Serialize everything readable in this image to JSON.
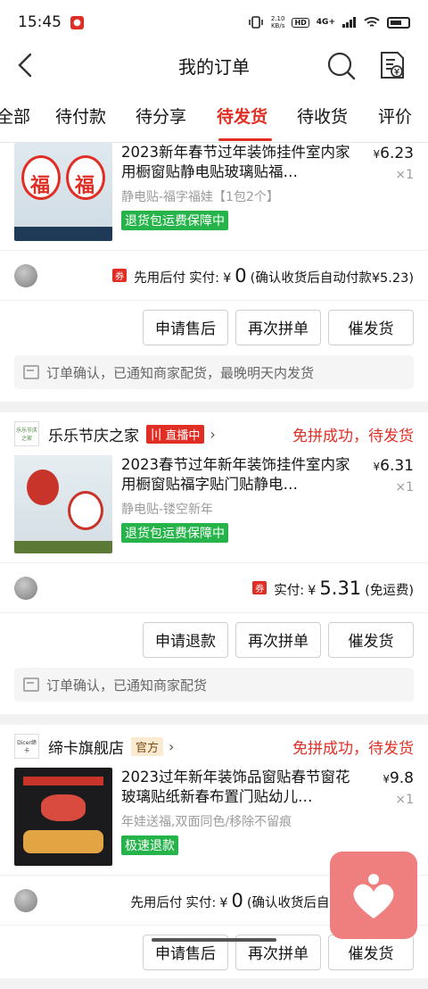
{
  "status_bar": {
    "time": "15:45",
    "net_speed_value": "2.10",
    "net_speed_unit": "KB/s",
    "hd": "HD",
    "signal": "4G+"
  },
  "nav": {
    "title": "我的订单"
  },
  "tabs": [
    {
      "label": "全部"
    },
    {
      "label": "待付款"
    },
    {
      "label": "待分享"
    },
    {
      "label": "待发货",
      "active": true
    },
    {
      "label": "待收货"
    },
    {
      "label": "评价"
    }
  ],
  "orders": [
    {
      "goods_title": "2023新年春节过年装饰挂件室内家用橱窗贴静电贴玻璃贴福…",
      "goods_spec": "静电贴-福字福娃【1包2个】",
      "guarantee": "退货包运费保障中",
      "price": "6.23",
      "quantity": "×1",
      "pay_prefix": "先用后付",
      "pay_label": "实付:",
      "pay_amount": "0",
      "pay_note": "(确认收货后自动付款¥5.23)",
      "coupon": "券",
      "buttons": [
        "申请售后",
        "再次拼单",
        "催发货"
      ],
      "notice": "订单确认，已通知商家配货，最晚明天内发货"
    },
    {
      "shop_name": "乐乐节庆之家",
      "shop_logo_text": "乐乐节庆之家",
      "shop_badge": "直播中",
      "status": "免拼成功，待发货",
      "goods_title": "2023春节过年新年装饰挂件室内家用橱窗贴福字贴门贴静电…",
      "goods_spec": "静电贴-镂空新年",
      "guarantee": "退货包运费保障中",
      "price": "6.31",
      "quantity": "×1",
      "pay_label": "实付:",
      "pay_amount": "5.31",
      "pay_note": "(免运费)",
      "coupon": "券",
      "buttons": [
        "申请退款",
        "再次拼单",
        "催发货"
      ],
      "notice": "订单确认，已通知商家配货"
    },
    {
      "shop_name": "缔卡旗舰店",
      "shop_logo_text": "Dicer缔卡",
      "shop_badge": "官方",
      "status": "免拼成功，待发货",
      "goods_title": "2023过年新年装饰品窗贴春节窗花玻璃贴纸新春布置门贴幼儿…",
      "goods_spec": "年娃送福,双面同色/移除不留痕",
      "guarantee": "极速退款",
      "price": "9.8",
      "quantity": "×1",
      "pay_prefix": "先用后付",
      "pay_label": "实付:",
      "pay_amount": "0",
      "pay_note": "(确认收货后自动",
      "buttons": [
        "申请售后",
        "再次拼单",
        "催发货"
      ]
    }
  ],
  "currency": "¥",
  "colors": {
    "accent": "#e02e24",
    "guarantee_green": "#25b34a"
  }
}
